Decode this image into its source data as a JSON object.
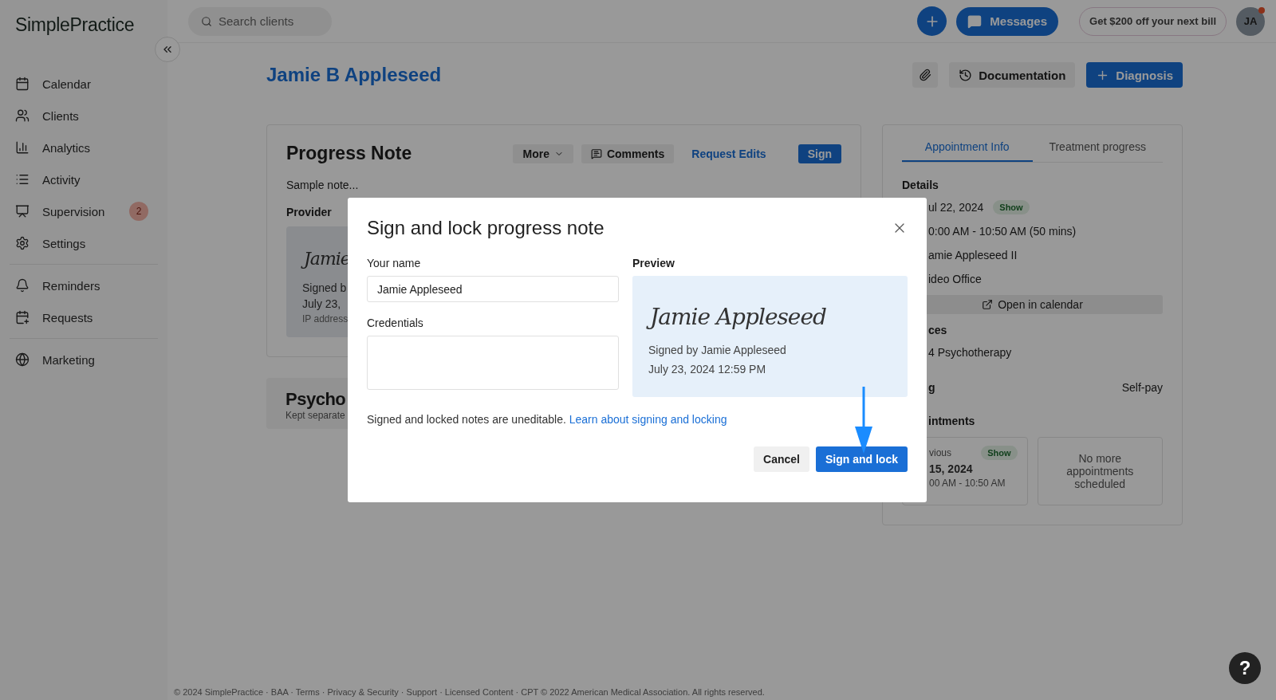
{
  "logo": "SimplePractice",
  "search": {
    "placeholder": "Search clients"
  },
  "topbar": {
    "messages": "Messages",
    "promo": "Get $200 off your next bill",
    "avatar": "JA",
    "avatar_alert": true
  },
  "sidebar": {
    "groups": [
      [
        {
          "label": "Calendar"
        },
        {
          "label": "Clients"
        },
        {
          "label": "Analytics"
        },
        {
          "label": "Activity"
        },
        {
          "label": "Supervision",
          "badge": "2"
        },
        {
          "label": "Settings"
        }
      ],
      [
        {
          "label": "Reminders"
        },
        {
          "label": "Requests"
        }
      ],
      [
        {
          "label": "Marketing"
        }
      ]
    ]
  },
  "client": {
    "name": "Jamie B Appleseed"
  },
  "header_buttons": [
    {
      "kind": "attach"
    },
    {
      "kind": "history",
      "label": "Documentation"
    },
    {
      "kind": "primary",
      "label": "Diagnosis"
    }
  ],
  "progress_note": {
    "title": "Progress Note",
    "actions": [
      {
        "kind": "dropdown",
        "label": "More"
      },
      {
        "kind": "comment",
        "label": "Comments"
      },
      {
        "kind": "link",
        "label": "Request Edits"
      },
      {
        "kind": "primary",
        "label": "Sign"
      }
    ],
    "body": "Sample note...",
    "provider_label": "Provider",
    "signature": {
      "script": "Jamie",
      "signed_by": "Signed b",
      "date": "July 23,",
      "ip": "IP address"
    }
  },
  "psychotherapy_card": {
    "title": "Psycho",
    "subtitle": "Kept separate"
  },
  "appointment_panel": {
    "tabs": [
      {
        "label": "Appointment Info",
        "selected": true
      },
      {
        "label": "Treatment progress",
        "selected": false
      }
    ],
    "details_label": "Details",
    "date": "ul 22, 2024",
    "date_status": "Show",
    "time": "0:00 AM - 10:50 AM (50 mins)",
    "clinician": "amie Appleseed II",
    "location": "ideo Office",
    "open_calendar": "Open in calendar",
    "services_label": "ces",
    "service": "4 Psychotherapy",
    "billing_label": "g",
    "billing_value": "Self-pay",
    "appointments_label": "intments",
    "previous": {
      "label": "vious",
      "status": "Show",
      "date": "15, 2024",
      "time": "00 AM - 10:50 AM"
    },
    "next": "No more appointments scheduled"
  },
  "dialog": {
    "title": "Sign and lock progress note",
    "name_label": "Your name",
    "name_value": "Jamie Appleseed",
    "credentials_label": "Credentials",
    "preview_label": "Preview",
    "preview": {
      "script": "Jamie Appleseed",
      "signed_by": "Signed by Jamie Appleseed",
      "date": "July 23, 2024 12:59 PM"
    },
    "note": "Signed and locked notes are uneditable.",
    "link": "Learn about signing and locking",
    "cancel": "Cancel",
    "confirm": "Sign and lock"
  },
  "footer": "© 2024 SimplePractice · BAA · Terms · Privacy & Security · Support · Licensed Content · CPT © 2022 American Medical Association. All rights reserved.",
  "help": "?"
}
